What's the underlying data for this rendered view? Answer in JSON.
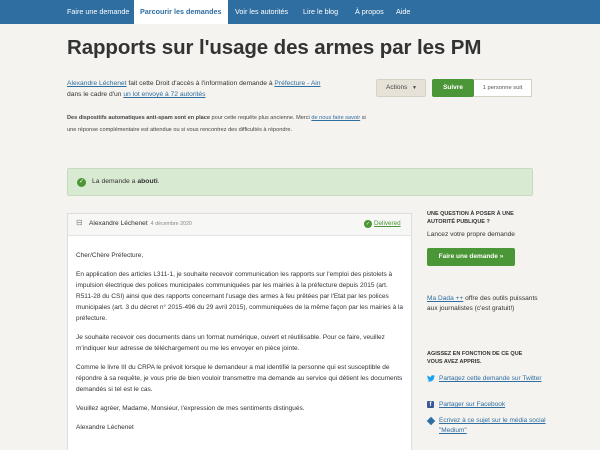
{
  "nav": {
    "items": [
      "Faire une demande",
      "Parcourir les demandes",
      "Voir les autorités",
      "Lire le blog",
      "À propos",
      "Aide"
    ]
  },
  "page": {
    "title": "Rapports sur l'usage des armes par les PM",
    "intro": {
      "requester": "Alexandre Léchenet",
      "text1": " fait cette Droit d'accès à l'information demande à ",
      "authority": "Préfecture - Ain",
      "text2": "dans le cadre d'un ",
      "batch_link": "un lot envoyé à 72 autorités"
    },
    "notice": {
      "bold": "Des dispositifs automatiques anti-spam sont en place",
      "text1": " pour cette requête plus ancienne. Merci ",
      "link": "de nous faire savoir",
      "text2": " si une réponse complémentaire est attendue ou si vous rencontrez des difficultés à répondre."
    },
    "status": {
      "prefix": "La demande a ",
      "value": "abouti",
      "suffix": "."
    }
  },
  "buttons": {
    "actions": "Actions",
    "follow": "Suivre",
    "follow_count": "1 personne suit"
  },
  "correspondence": {
    "author": "Alexandre Léchenet",
    "date": "4 décembre 2020",
    "delivered": "Delivered",
    "paragraphs": [
      "Cher/Chère Préfecture,",
      "En application des articles L311-1, je souhaite recevoir communication les rapports sur l'emploi des pistolets à impulsion électrique des polices municipales communiquées par les mairies à la préfecture depuis 2015 (art. R511-28 du CSI) ainsi que des rapports concernant l'usage des armes à feu prêtées par l'Etat par les polices municipales (art. 3 du décret n° 2015-496 du 29 avril 2015), communiquées de la même façon par les mairies à la préfecture.",
      "Je souhaite recevoir ces documents dans un format numérique, ouvert et réutilisable. Pour ce faire, veuillez m'indiquer leur adresse de téléchargement ou me les envoyer en pièce jointe.",
      "Comme le livre III du CRPA le prévoit lorsque le demandeur a mal identifié la personne qui est susceptible de répondre à sa requête, je vous prie de bien vouloir transmettre ma demande au service qui détient les documents demandés si tel est le cas.",
      "Veuillez agréer, Madame, Monsieur, l'expression de mes sentiments distingués.",
      "Alexandre Léchenet"
    ]
  },
  "sidebar": {
    "question_heading": "Une question à poser à une autorité publique ?",
    "question_text": "Lancez votre propre demande",
    "ask_button": "Faire une demande »",
    "madada_link": "Ma Dada ++",
    "madada_text": " offre des outils puissants aux journalistes (c'est gratuit!)",
    "share_heading": "Agissez en fonction de ce que vous avez appris.",
    "share_items": [
      {
        "icon": "twitter-icon",
        "label": "Partagez cette demande sur Twitter"
      },
      {
        "icon": "facebook-icon",
        "label": "Partager sur Facebook"
      },
      {
        "icon": "medium-icon",
        "label": "Ecrivez à ce sujet sur le média social \"Medium\""
      }
    ]
  },
  "colors": {
    "nav": "#2f6ea1",
    "accent_green": "#4b9636",
    "banner": "#d9ead3",
    "background": "#f4f3ef"
  }
}
